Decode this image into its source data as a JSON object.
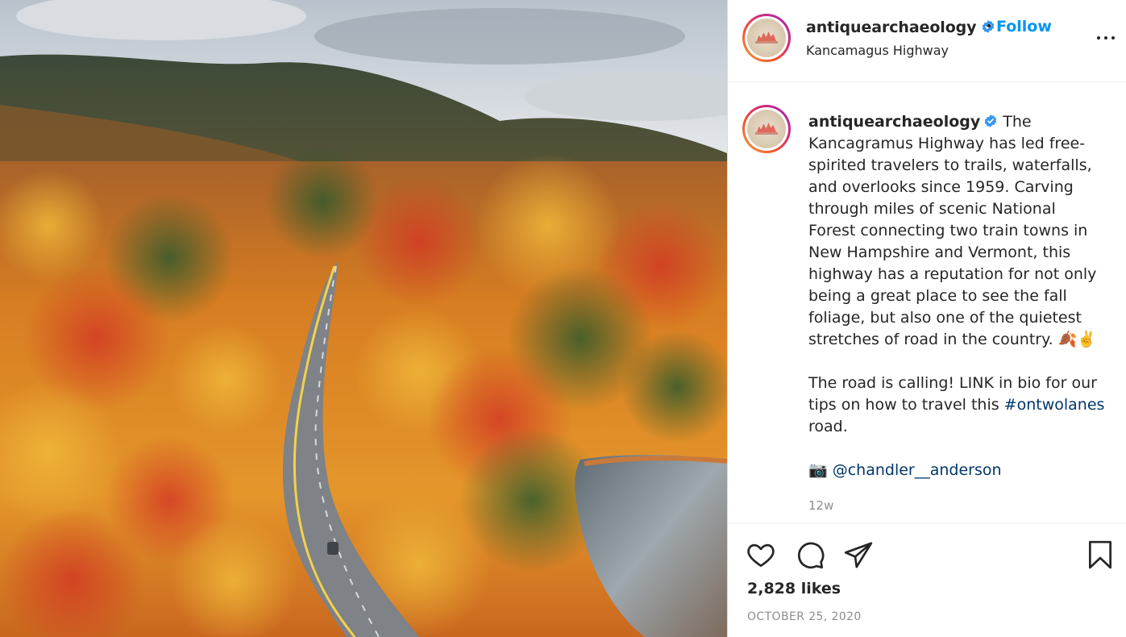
{
  "post": {
    "image_alt": "Aerial view of a road through autumn forest beside a lake",
    "colors": {
      "accent": "#0095f6",
      "link": "#00376b",
      "muted": "#8e8e8e",
      "text": "#262626",
      "verified": "#3897f0"
    }
  },
  "header": {
    "username": "antiquearchaeology",
    "verified_icon": "verified-badge-icon",
    "separator": "•",
    "follow_label": "Follow",
    "location": "Kancamagus Highway",
    "more_icon": "more-options-icon"
  },
  "caption": {
    "username": "antiquearchaeology",
    "body": "The Kancagramus Highway has led free-spirited travelers to trails, waterfalls, and overlooks since 1959. Carving through miles of scenic National Forest connecting two train towns in New Hampshire and Vermont, this highway has a reputation for not only being a great place to see the fall foliage, but also one of the quietest stretches of road in the country.",
    "emoji": "🍂✌️",
    "cta_text": "The road is calling! LINK in bio for our tips on how to travel this",
    "hashtag": "#ontwolanes",
    "cta_tail": "road.",
    "credit_icon": "📷",
    "credit_mention": "@chandler__anderson",
    "time_ago": "12w"
  },
  "actions": {
    "like_icon": "heart-icon",
    "comment_icon": "comment-icon",
    "share_icon": "share-icon",
    "save_icon": "bookmark-icon",
    "likes": "2,828 likes",
    "date": "OCTOBER 25, 2020"
  }
}
